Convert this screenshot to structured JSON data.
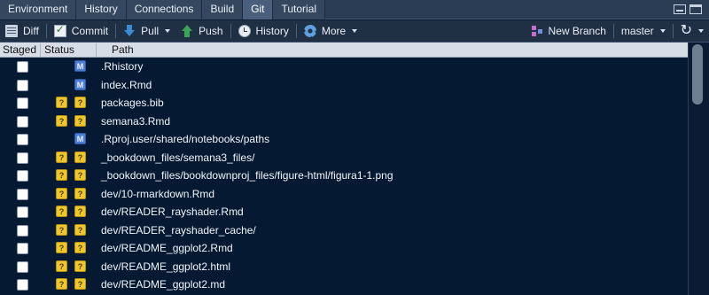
{
  "tabs": [
    {
      "label": "Environment",
      "active": false
    },
    {
      "label": "History",
      "active": false
    },
    {
      "label": "Connections",
      "active": false
    },
    {
      "label": "Build",
      "active": false
    },
    {
      "label": "Git",
      "active": true
    },
    {
      "label": "Tutorial",
      "active": false
    }
  ],
  "toolbar": {
    "diff": "Diff",
    "commit": "Commit",
    "pull": "Pull",
    "push": "Push",
    "history": "History",
    "more": "More",
    "new_branch": "New Branch",
    "branch": "master",
    "refresh_glyph": "↻"
  },
  "columns": {
    "staged": "Staged",
    "status": "Status",
    "path": "Path"
  },
  "files": [
    {
      "path": ".Rhistory",
      "status": [
        "",
        "M"
      ]
    },
    {
      "path": "index.Rmd",
      "status": [
        "",
        "M"
      ]
    },
    {
      "path": "packages.bib",
      "status": [
        "?",
        "?"
      ]
    },
    {
      "path": "semana3.Rmd",
      "status": [
        "?",
        "?"
      ]
    },
    {
      "path": ".Rproj.user/shared/notebooks/paths",
      "status": [
        "",
        "M"
      ]
    },
    {
      "path": "_bookdown_files/semana3_files/",
      "status": [
        "?",
        "?"
      ]
    },
    {
      "path": "_bookdown_files/bookdownproj_files/figure-html/figura1-1.png",
      "status": [
        "?",
        "?"
      ]
    },
    {
      "path": "dev/10-rmarkdown.Rmd",
      "status": [
        "?",
        "?"
      ]
    },
    {
      "path": "dev/READER_rayshader.Rmd",
      "status": [
        "?",
        "?"
      ]
    },
    {
      "path": "dev/READER_rayshader_cache/",
      "status": [
        "?",
        "?"
      ]
    },
    {
      "path": "dev/README_ggplot2.Rmd",
      "status": [
        "?",
        "?"
      ]
    },
    {
      "path": "dev/README_ggplot2.html",
      "status": [
        "?",
        "?"
      ]
    },
    {
      "path": "dev/README_ggplot2.md",
      "status": [
        "?",
        "?"
      ]
    }
  ],
  "colors": {
    "background": "#051932",
    "untracked_badge": "#efc72b",
    "modified_badge": "#4b7fd4"
  }
}
